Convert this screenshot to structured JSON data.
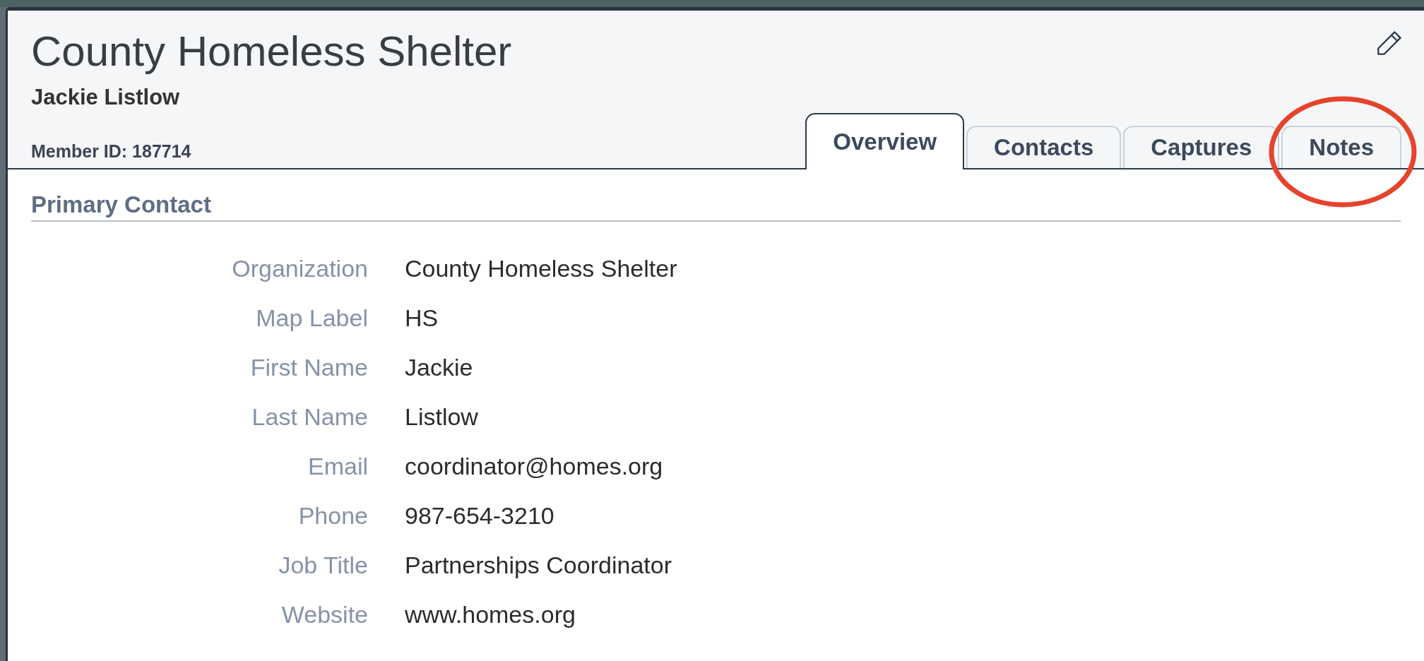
{
  "header": {
    "title": "County Homeless Shelter",
    "subtitle": "Jackie Listlow",
    "member_id": "Member ID: 187714"
  },
  "tabs": [
    {
      "label": "Overview",
      "selected": true,
      "circled": false
    },
    {
      "label": "Contacts",
      "selected": false,
      "circled": false
    },
    {
      "label": "Captures",
      "selected": false,
      "circled": false
    },
    {
      "label": "Notes",
      "selected": false,
      "circled": true
    }
  ],
  "section": {
    "title": "Primary Contact",
    "fields": [
      {
        "label": "Organization",
        "value": "County Homeless Shelter"
      },
      {
        "label": "Map Label",
        "value": "HS"
      },
      {
        "label": "First Name",
        "value": "Jackie"
      },
      {
        "label": "Last Name",
        "value": "Listlow"
      },
      {
        "label": "Email",
        "value": "coordinator@homes.org"
      },
      {
        "label": "Phone",
        "value": "987-654-3210"
      },
      {
        "label": "Job Title",
        "value": "Partnerships Coordinator"
      },
      {
        "label": "Website",
        "value": "www.homes.org"
      }
    ]
  }
}
